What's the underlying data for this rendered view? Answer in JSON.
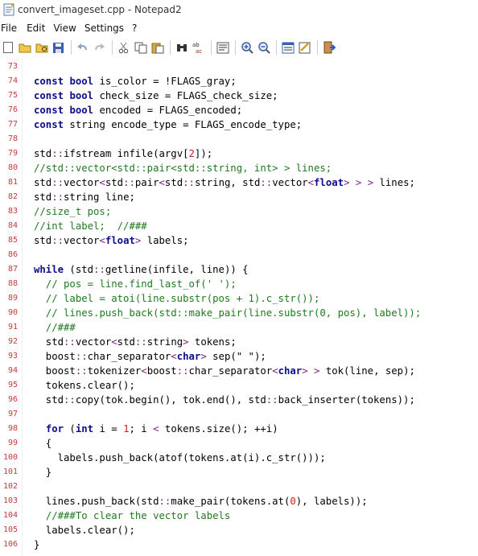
{
  "window": {
    "title": "convert_imageset.cpp - Notepad2"
  },
  "menu": [
    "File",
    "Edit",
    "View",
    "Settings",
    "?"
  ],
  "toolbar": {
    "icons": [
      "new-icon",
      "open-icon",
      "browse-icon",
      "save-icon",
      "undo-icon",
      "redo-icon",
      "cut-icon",
      "copy-icon",
      "paste-icon",
      "find-icon",
      "replace-icon",
      "wordwrap-icon",
      "zoom-in-icon",
      "zoom-out-icon",
      "scheme-icon",
      "customize-icon",
      "exit-icon"
    ]
  },
  "editor": {
    "lines": [
      {
        "n": "73",
        "code": ""
      },
      {
        "n": "74",
        "code": "const bool is_color = !FLAGS_gray;"
      },
      {
        "n": "75",
        "code": "const bool check_size = FLAGS_check_size;"
      },
      {
        "n": "76",
        "code": "const bool encoded = FLAGS_encoded;"
      },
      {
        "n": "77",
        "code": "const string encode_type = FLAGS_encode_type;"
      },
      {
        "n": "78",
        "code": ""
      },
      {
        "n": "79",
        "code": "std::ifstream infile(argv[2]);"
      },
      {
        "n": "80",
        "code": "//std::vector<std::pair<std::string, int> > lines;"
      },
      {
        "n": "81",
        "code": "std::vector<std::pair<std::string, std::vector<float> > > lines;"
      },
      {
        "n": "82",
        "code": "std::string line;"
      },
      {
        "n": "83",
        "code": "//size_t pos;"
      },
      {
        "n": "84",
        "code": "//int label;  //###"
      },
      {
        "n": "85",
        "code": "std::vector<float> labels;"
      },
      {
        "n": "86",
        "code": ""
      },
      {
        "n": "87",
        "code": "while (std::getline(infile, line)) {"
      },
      {
        "n": "88",
        "code": "  // pos = line.find_last_of(' ');"
      },
      {
        "n": "89",
        "code": "  // label = atoi(line.substr(pos + 1).c_str());"
      },
      {
        "n": "90",
        "code": "  // lines.push_back(std::make_pair(line.substr(0, pos), label));"
      },
      {
        "n": "91",
        "code": "  //###"
      },
      {
        "n": "92",
        "code": "  std::vector<std::string> tokens;"
      },
      {
        "n": "93",
        "code": "  boost::char_separator<char> sep(\" \");"
      },
      {
        "n": "94",
        "code": "  boost::tokenizer<boost::char_separator<char> > tok(line, sep);"
      },
      {
        "n": "95",
        "code": "  tokens.clear();"
      },
      {
        "n": "96",
        "code": "  std::copy(tok.begin(), tok.end(), std::back_inserter(tokens));"
      },
      {
        "n": "97",
        "code": ""
      },
      {
        "n": "98",
        "code": "  for (int i = 1; i < tokens.size(); ++i)"
      },
      {
        "n": "99",
        "code": "  {"
      },
      {
        "n": "100",
        "code": "    labels.push_back(atof(tokens.at(i).c_str()));"
      },
      {
        "n": "101",
        "code": "  }"
      },
      {
        "n": "102",
        "code": ""
      },
      {
        "n": "103",
        "code": "  lines.push_back(std::make_pair(tokens.at(0), labels));"
      },
      {
        "n": "104",
        "code": "  //###To clear the vector labels"
      },
      {
        "n": "105",
        "code": "  labels.clear();"
      },
      {
        "n": "106",
        "code": "}"
      }
    ]
  },
  "colors": {
    "line_number": "#c83a3a",
    "keyword": "#0c0c8c",
    "comment": "#1f7a1f",
    "number": "#c81e1e",
    "namespace": "#7a1e7a"
  }
}
